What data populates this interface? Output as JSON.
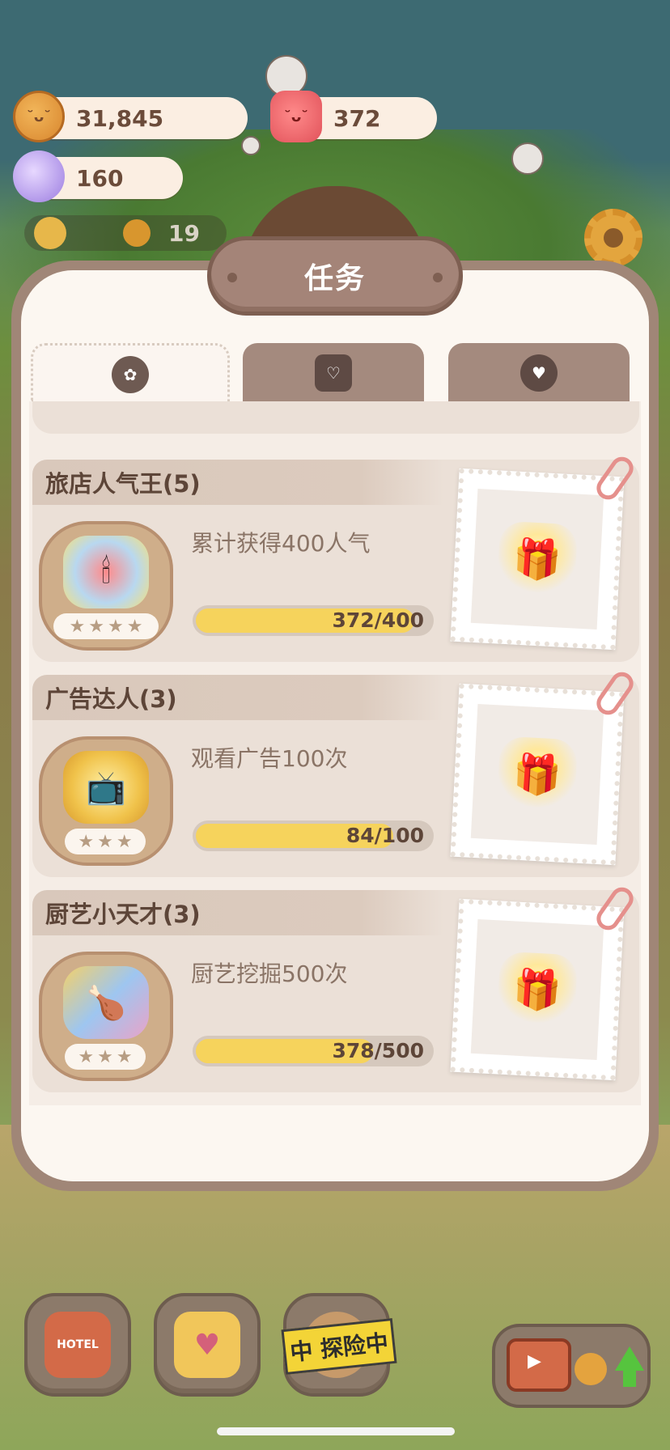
{
  "resources": {
    "cookies": "31,845",
    "candles": "372",
    "gems": "160",
    "popularity": "19"
  },
  "panel": {
    "title": "任务"
  },
  "tabs": [
    {
      "icon": "paw-medal-icon",
      "active": true
    },
    {
      "icon": "note-heart-icon",
      "active": false
    },
    {
      "icon": "heart-bottle-icon",
      "active": false
    }
  ],
  "quests": [
    {
      "title": "旅店人气王(5)",
      "description": "累计获得400人气",
      "progress_text": "372/400",
      "progress": 0.93,
      "badge_icon": "candle-badge-icon",
      "stars_total": 4,
      "reward_icon": "gift-box-icon"
    },
    {
      "title": "广告达人(3)",
      "description": "观看广告100次",
      "progress_text": "84/100",
      "progress": 0.84,
      "badge_icon": "tv-badge-icon",
      "stars_total": 3,
      "reward_icon": "gift-box-icon"
    },
    {
      "title": "厨艺小天才(3)",
      "description": "厨艺挖掘500次",
      "progress_text": "378/500",
      "progress": 0.756,
      "badge_icon": "cooking-badge-icon",
      "stars_total": 3,
      "reward_icon": "gift-box-icon"
    }
  ],
  "bottom_bar": {
    "tape_text": "中 探险中",
    "buttons": [
      "hotel-icon",
      "diary-icon",
      "adventure-icon",
      "ad-boost-icon"
    ]
  },
  "colors": {
    "panel_bg": "#fcf7f1",
    "panel_border": "#a08677",
    "progress_fill": "#f6d35c",
    "ribbon": "#d9c8bb",
    "title_plate": "#a48478"
  }
}
